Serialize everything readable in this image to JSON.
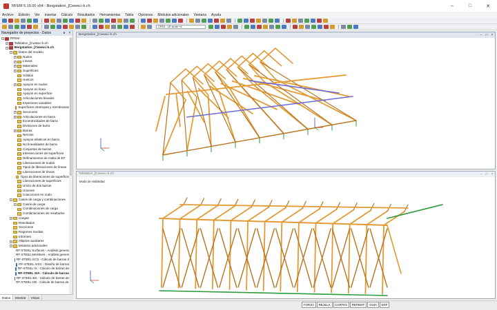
{
  "window": {
    "title": "RFEM 5.19.00 x64 - Bergstation_[Cwww.i-b.ch",
    "minimize": "–",
    "maximize": "□",
    "close": "✕"
  },
  "menu": [
    "Archivo",
    "Edición",
    "Ver",
    "Insertar",
    "Cálculo",
    "Resultados",
    "Herramientas",
    "Tabla",
    "Opciones",
    "Módulos adicionales",
    "Ventana",
    "Ayuda"
  ],
  "toolbar": {
    "combo_value": "CR31 - LE Arnie +4"
  },
  "navigator": {
    "title": "Navegador de proyectos - Datos",
    "pin": "ᵾ",
    "close": "×",
    "items": [
      {
        "label": "RFEM",
        "indent": 0,
        "icon": "proj",
        "exp": "−"
      },
      {
        "label": "Talstation_[Cwww.i-b.ch",
        "indent": 1,
        "icon": "proj",
        "exp": "+"
      },
      {
        "label": "Bergstation_[Cwww.i-b.ch",
        "indent": 1,
        "icon": "proj",
        "exp": "−",
        "bold": true
      },
      {
        "label": "Datos del modelo",
        "indent": 2,
        "icon": "fold",
        "exp": "−"
      },
      {
        "label": "Nudos",
        "indent": 3,
        "icon": "fold",
        "exp": "+"
      },
      {
        "label": "Líneas",
        "indent": 3,
        "icon": "fold",
        "exp": "+"
      },
      {
        "label": "Materiales",
        "indent": 3,
        "icon": "fold",
        "exp": "+"
      },
      {
        "label": "Superficies",
        "indent": 3,
        "icon": "fold",
        "exp": "+"
      },
      {
        "label": "Sólidos",
        "indent": 3,
        "icon": "fold",
        "exp": ""
      },
      {
        "label": "Huecos",
        "indent": 3,
        "icon": "fold",
        "exp": ""
      },
      {
        "label": "Apoyos en nudos",
        "indent": 3,
        "icon": "fold",
        "exp": "+"
      },
      {
        "label": "Apoyos en línea",
        "indent": 3,
        "icon": "fold",
        "exp": ""
      },
      {
        "label": "Apoyos en superficie",
        "indent": 3,
        "icon": "fold",
        "exp": ""
      },
      {
        "label": "Articulaciones lineales",
        "indent": 3,
        "icon": "fold",
        "exp": ""
      },
      {
        "label": "Espesores variables",
        "indent": 3,
        "icon": "fold",
        "exp": ""
      },
      {
        "label": "Superficies ortotropas y membranas",
        "indent": 3,
        "icon": "fold",
        "exp": ""
      },
      {
        "label": "Secciones",
        "indent": 3,
        "icon": "fold",
        "exp": "+"
      },
      {
        "label": "Articulaciones en barra",
        "indent": 3,
        "icon": "fold",
        "exp": "+"
      },
      {
        "label": "Excentricidades de barra",
        "indent": 3,
        "icon": "fold",
        "exp": ""
      },
      {
        "label": "Divisiones de barra",
        "indent": 3,
        "icon": "fold",
        "exp": ""
      },
      {
        "label": "Barras",
        "indent": 3,
        "icon": "fold",
        "exp": "+"
      },
      {
        "label": "Nervios",
        "indent": 3,
        "icon": "fold",
        "exp": ""
      },
      {
        "label": "Apoyos elásticos en barra",
        "indent": 3,
        "icon": "fold",
        "exp": ""
      },
      {
        "label": "No linealidades de barra",
        "indent": 3,
        "icon": "fold",
        "exp": ""
      },
      {
        "label": "Conjuntos de barras",
        "indent": 3,
        "icon": "fold",
        "exp": ""
      },
      {
        "label": "Intersecciones de superficies",
        "indent": 3,
        "icon": "fold",
        "exp": ""
      },
      {
        "label": "Refinamientos de malla de EF",
        "indent": 3,
        "icon": "fold",
        "exp": ""
      },
      {
        "label": "Liberaciones de nudos",
        "indent": 3,
        "icon": "fold",
        "exp": ""
      },
      {
        "label": "Tipos de liberaciones de líneas",
        "indent": 3,
        "icon": "fold",
        "exp": ""
      },
      {
        "label": "Liberaciones de líneas",
        "indent": 3,
        "icon": "fold",
        "exp": ""
      },
      {
        "label": "Tipos de liberaciones de superficie",
        "indent": 3,
        "icon": "fold",
        "exp": ""
      },
      {
        "label": "Liberaciones de superficies",
        "indent": 3,
        "icon": "fold",
        "exp": ""
      },
      {
        "label": "Unión de dos barras",
        "indent": 3,
        "icon": "fold",
        "exp": ""
      },
      {
        "label": "Uniones",
        "indent": 3,
        "icon": "fold",
        "exp": ""
      },
      {
        "label": "Coacciones en nudo",
        "indent": 3,
        "icon": "fold",
        "exp": ""
      },
      {
        "label": "Casos de carga y combinaciones",
        "indent": 2,
        "icon": "fold",
        "exp": "−"
      },
      {
        "label": "Casos de carga",
        "indent": 3,
        "icon": "fold",
        "exp": "+"
      },
      {
        "label": "Combinaciones de carga",
        "indent": 3,
        "icon": "fold",
        "exp": ""
      },
      {
        "label": "Combinaciones de resultados",
        "indent": 3,
        "icon": "fold",
        "exp": ""
      },
      {
        "label": "Cargas",
        "indent": 2,
        "icon": "fold",
        "exp": "+"
      },
      {
        "label": "Resultados",
        "indent": 2,
        "icon": "fold",
        "exp": ""
      },
      {
        "label": "Secciones",
        "indent": 2,
        "icon": "fold",
        "exp": ""
      },
      {
        "label": "Regiones medias",
        "indent": 2,
        "icon": "fold",
        "exp": ""
      },
      {
        "label": "Informes",
        "indent": 2,
        "icon": "fold",
        "exp": ""
      },
      {
        "label": "Objetos auxiliares",
        "indent": 2,
        "icon": "fold",
        "exp": "+"
      },
      {
        "label": "Módulos adicionales",
        "indent": 2,
        "icon": "fold",
        "exp": "−"
      },
      {
        "label": "RF-STEEL Surfaces - Análisis general",
        "indent": 3,
        "icon": "mod",
        "exp": ""
      },
      {
        "label": "RF-STEEL Members - Análisis general",
        "indent": 3,
        "icon": "mod",
        "exp": ""
      },
      {
        "label": "RF-STEEL EC3 - Cálculo de barras d",
        "indent": 3,
        "icon": "mod",
        "exp": ""
      },
      {
        "label": "RF-STEEL AISC - Diseño de barras",
        "indent": 3,
        "icon": "mod",
        "exp": ""
      },
      {
        "label": "RF-STEEL IS - Cálculo de barras de",
        "indent": 3,
        "icon": "mod",
        "exp": ""
      },
      {
        "label": "RF-STEEL SIA - Cálculo de barras",
        "indent": 3,
        "icon": "mod",
        "exp": "",
        "bold": true
      },
      {
        "label": "RF-STEEL BS - Cálculo de barras de",
        "indent": 3,
        "icon": "mod",
        "exp": ""
      },
      {
        "label": "RF-STEEL GB - Cálculo de barras de a",
        "indent": 3,
        "icon": "mod",
        "exp": ""
      }
    ],
    "tabs": [
      "Datos",
      "Mostrar",
      "Vistas"
    ]
  },
  "view1": {
    "title": "Bergstation_[Cwww.i-b.ch"
  },
  "view2": {
    "title": "Talstation_[Cwww.i-b.ch",
    "mode_label": "Modo de visibilidad"
  },
  "status": {
    "buttons": [
      "FORJO",
      "REJILLA",
      "CARTES",
      "REFEDIT",
      "GUIA",
      "DXF"
    ]
  }
}
